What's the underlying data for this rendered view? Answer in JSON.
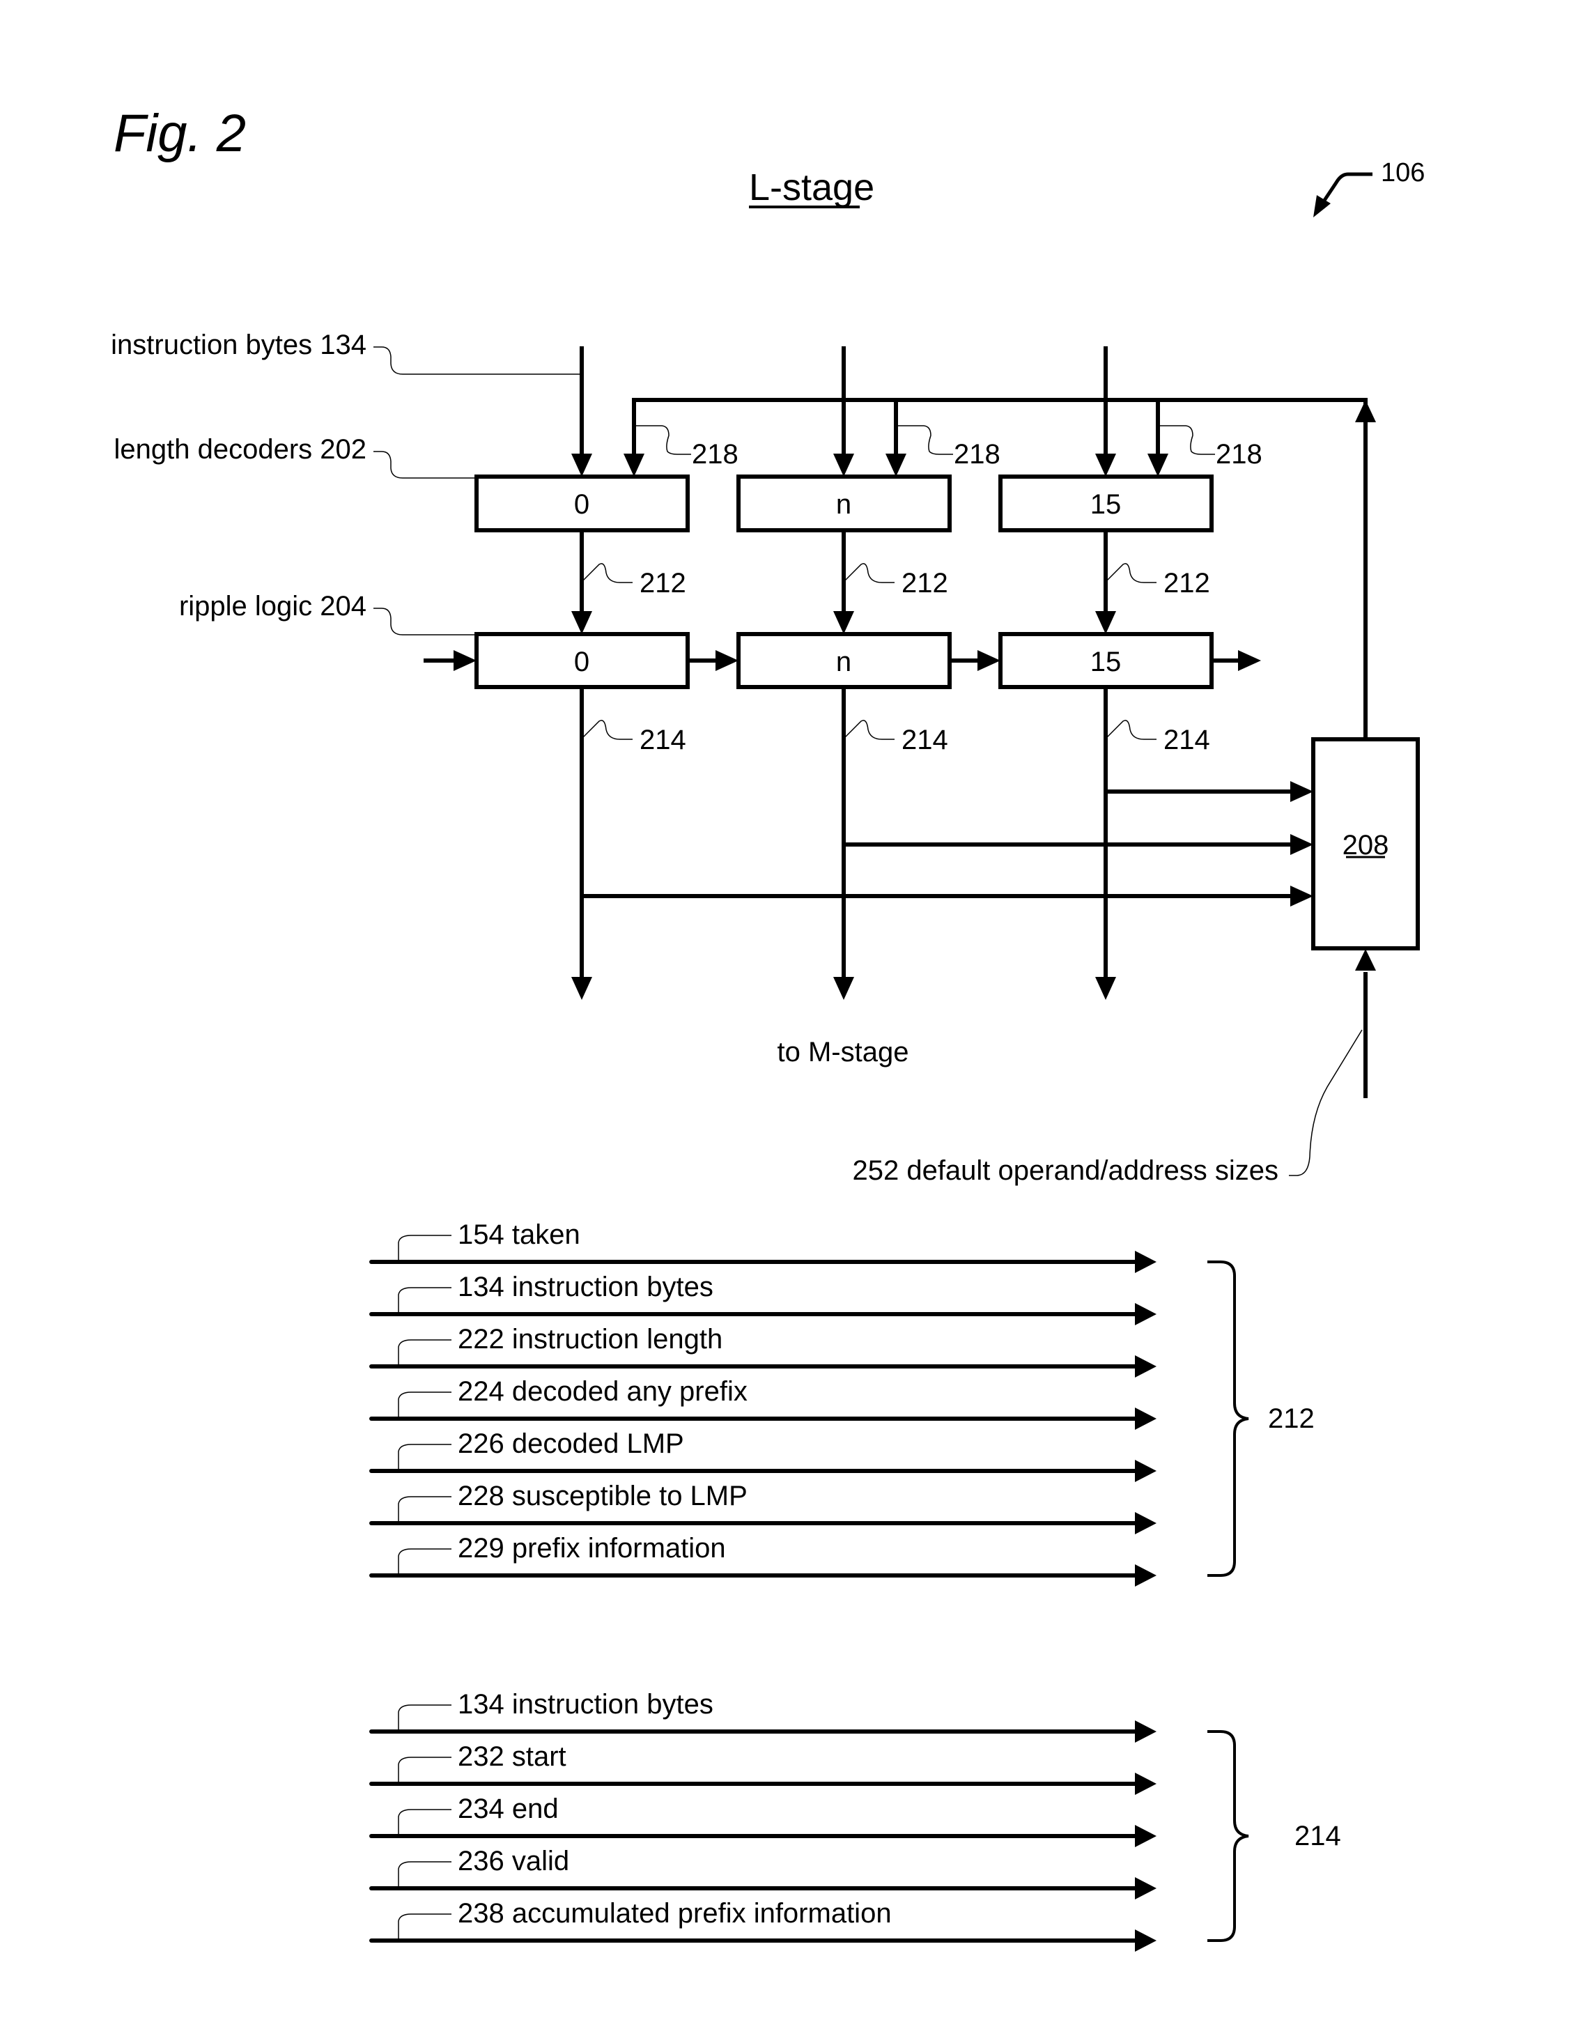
{
  "figure": {
    "fig_label": "Fig. 2",
    "title": "L-stage",
    "ref_number": "106"
  },
  "left_labels": {
    "instruction_bytes": "instruction bytes  134",
    "length_decoders": "length decoders  202",
    "ripple_logic": "ripple logic  204"
  },
  "columns": [
    {
      "decoder_label": "0",
      "ripple_label": "0",
      "ref_218": "218",
      "ref_212": "212",
      "ref_214": "214"
    },
    {
      "decoder_label": "n",
      "ripple_label": "n",
      "ref_218": "218",
      "ref_212": "212",
      "ref_214": "214"
    },
    {
      "decoder_label": "15",
      "ripple_label": "15",
      "ref_218": "218",
      "ref_212": "212",
      "ref_214": "214"
    }
  ],
  "block_208": {
    "label": "208"
  },
  "output_label": "to M-stage",
  "default_sizes_label": "252 default operand/address sizes",
  "signal_groups": [
    {
      "ref": "212",
      "signals": [
        "154 taken",
        "134 instruction bytes",
        "222 instruction length",
        "224 decoded any prefix",
        "226 decoded LMP",
        "228 susceptible to LMP",
        "229 prefix information"
      ]
    },
    {
      "ref": "214",
      "signals": [
        "134 instruction bytes",
        "232 start",
        "234 end",
        "236 valid",
        "238 accumulated prefix information"
      ]
    }
  ]
}
